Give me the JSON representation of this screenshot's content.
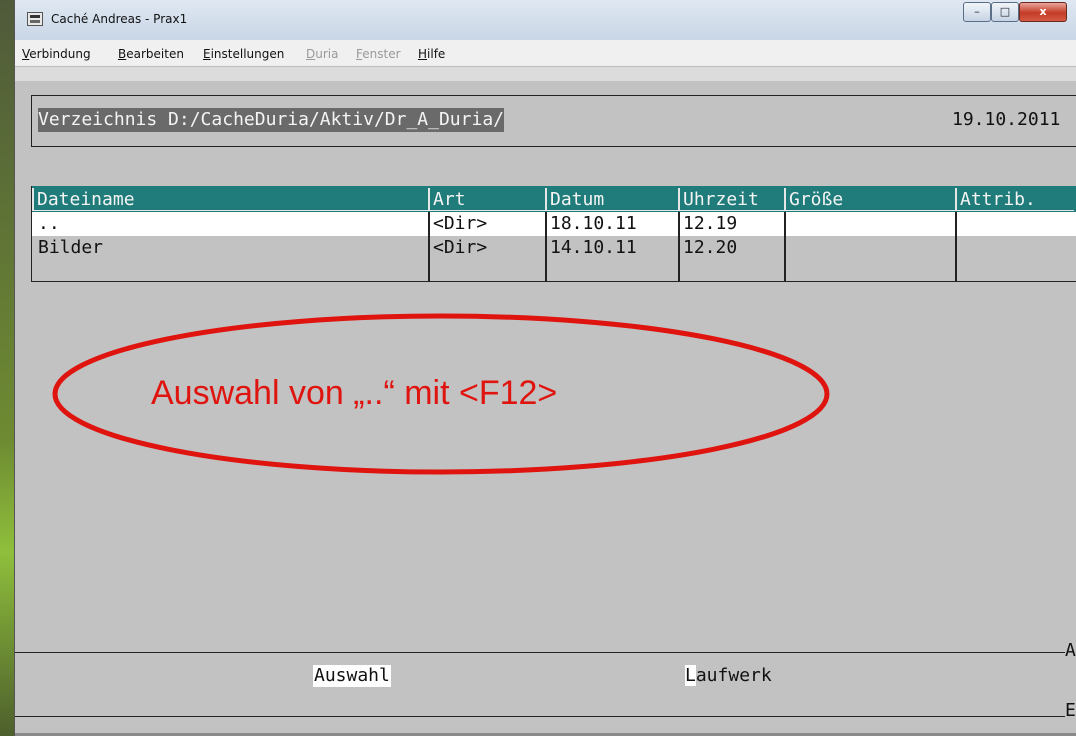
{
  "window": {
    "title": "Caché Andreas - Prax1",
    "min_glyph": "–",
    "max_glyph": "□",
    "close_glyph": "x"
  },
  "menu": {
    "verbindung": {
      "hot": "V",
      "rest": "erbindung"
    },
    "bearbeiten": {
      "hot": "B",
      "rest": "earbeiten"
    },
    "einstellungen": {
      "hot": "E",
      "rest": "instellungen"
    },
    "duria": {
      "hot": "D",
      "rest": "uria"
    },
    "fenster": {
      "hot": "F",
      "rest": "enster"
    },
    "hilfe": {
      "hot": "H",
      "rest": "ilfe"
    }
  },
  "header": {
    "path": "Verzeichnis D:/CacheDuria/Aktiv/Dr_A_Duria/",
    "date": "19.10.2011"
  },
  "table": {
    "columns": [
      "Dateiname",
      "Art",
      "Datum",
      "Uhrzeit",
      "Größe",
      "Attrib."
    ],
    "rows": [
      {
        "name": "..",
        "art": "<Dir>",
        "datum": "18.10.11",
        "uhrzeit": "12.19",
        "groesse": "",
        "attrib": ""
      },
      {
        "name": "Bilder",
        "art": "<Dir>",
        "datum": "14.10.11",
        "uhrzeit": "12.20",
        "groesse": "",
        "attrib": ""
      }
    ]
  },
  "annotation": {
    "text": "Auswahl von „..“ mit <F12>",
    "color": "#e0140f"
  },
  "footer": {
    "auswahl": "Auswahl",
    "laufwerk_hot": "L",
    "laufwerk_rest": "aufwerk",
    "edge_top": "A",
    "edge_bottom": "E"
  },
  "colors": {
    "header_bg": "#1f7c7a",
    "screen_bg": "#c2c2c2",
    "selected_row": "#ffffff"
  }
}
